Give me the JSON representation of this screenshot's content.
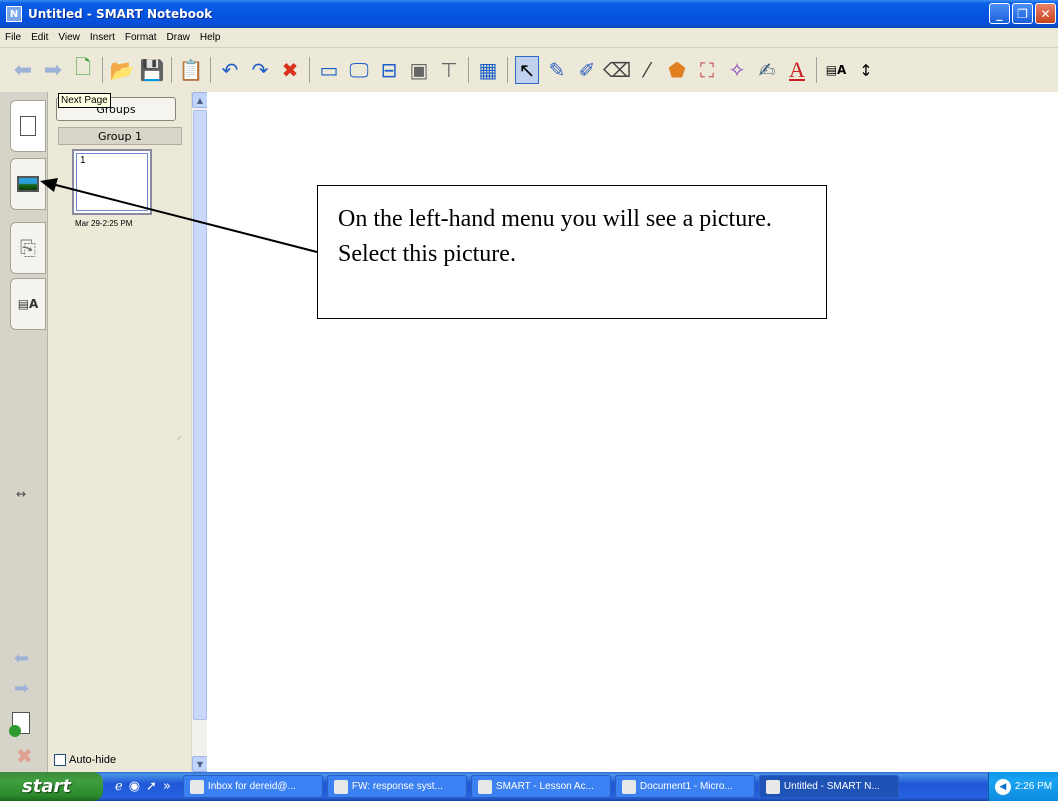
{
  "window": {
    "title": "Untitled - SMART Notebook",
    "app_icon_glyph": "N"
  },
  "menu": [
    "File",
    "Edit",
    "View",
    "Insert",
    "Format",
    "Draw",
    "Help"
  ],
  "toolbar": {
    "icons": [
      "previous-page-icon",
      "next-page-icon",
      "blank-page-icon",
      "open-file-icon",
      "save-icon",
      "paste-icon",
      "undo-icon",
      "redo-icon",
      "delete-icon",
      "screen-shade-icon",
      "full-screen-icon",
      "dual-page-icon",
      "capture-icon",
      "document-camera-icon",
      "table-icon",
      "select-icon",
      "pen-icon",
      "creative-pen-icon",
      "eraser-icon",
      "line-icon",
      "shapes-icon",
      "fill-icon",
      "magic-pen-icon",
      "shape-recognition-icon",
      "text-icon",
      "properties-icon",
      "move-toolbar-icon"
    ]
  },
  "sorter": {
    "tooltip": "Next Page",
    "groups_button": "Groups",
    "group_label": "Group 1",
    "page_number": "1",
    "page_date": "Mar 29-2:25 PM",
    "autohide_label": "Auto-hide"
  },
  "canvas": {
    "callout_text": "On the left-hand menu you will see a picture. Select this picture."
  },
  "taskbar": {
    "start_label": "start",
    "tasks": [
      "Inbox for dereid@...",
      "FW: response syst...",
      "SMART - Lesson Ac...",
      "Document1 - Micro...",
      "Untitled - SMART N..."
    ],
    "clock": "2:26 PM"
  }
}
